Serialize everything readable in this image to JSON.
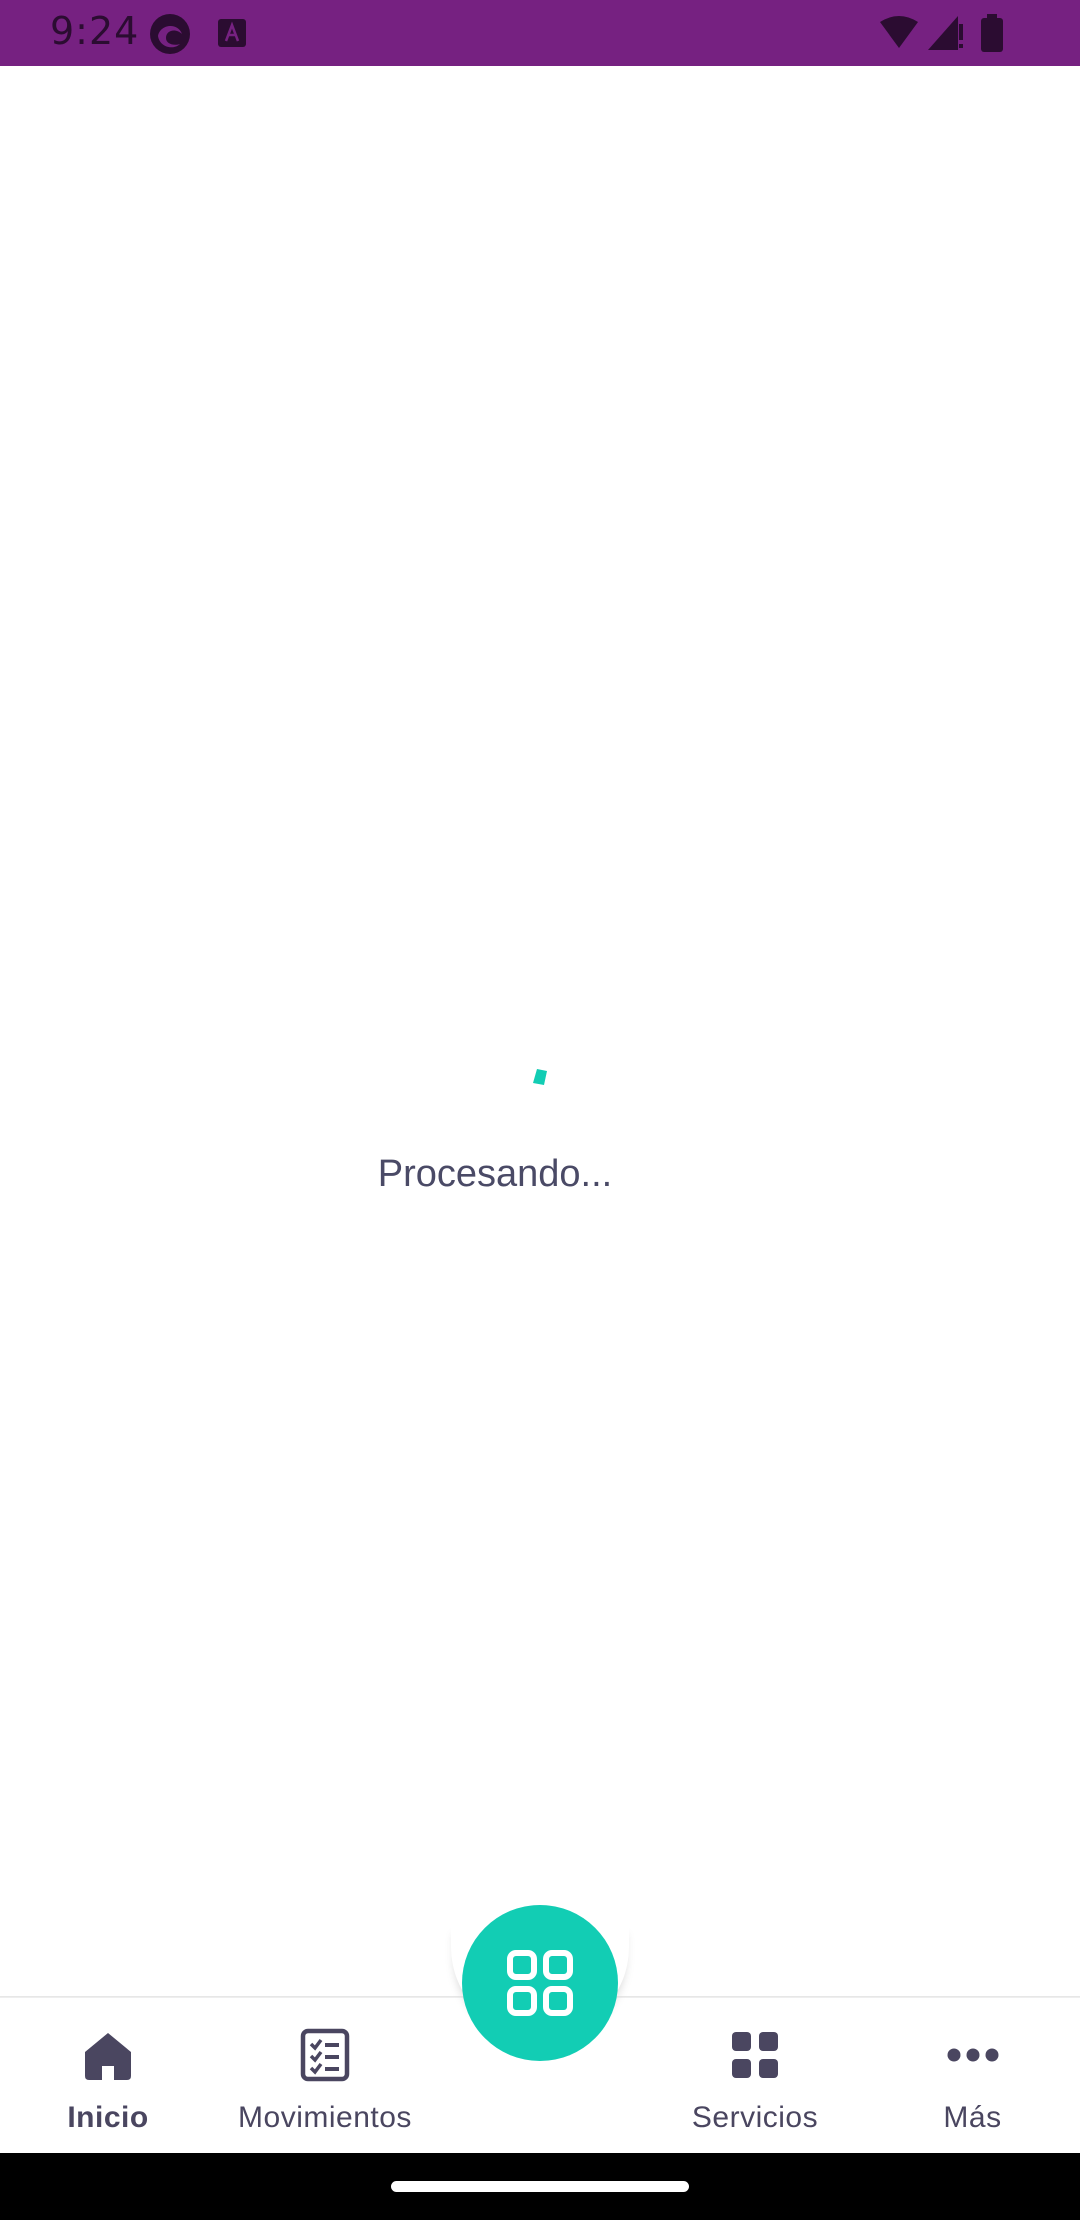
{
  "status_bar": {
    "time": "9:24",
    "icons": [
      "edge-icon",
      "font-a-icon",
      "wifi-icon",
      "signal-icon",
      "battery-icon"
    ],
    "background": "#762181"
  },
  "main": {
    "loading_text": "Procesando...",
    "spinner_color": "#12cdb4"
  },
  "bottom_nav": {
    "items": [
      {
        "label": "Inicio",
        "icon": "home-icon",
        "active": true
      },
      {
        "label": "Movimientos",
        "icon": "checklist-icon",
        "active": false
      },
      {
        "label": "Servicios",
        "icon": "grid-icon",
        "active": false
      },
      {
        "label": "Más",
        "icon": "more-horizontal-icon",
        "active": false
      }
    ],
    "fab": {
      "icon": "apps-grid-icon",
      "color": "#12cdb4"
    },
    "icon_color": "#4a4660"
  }
}
